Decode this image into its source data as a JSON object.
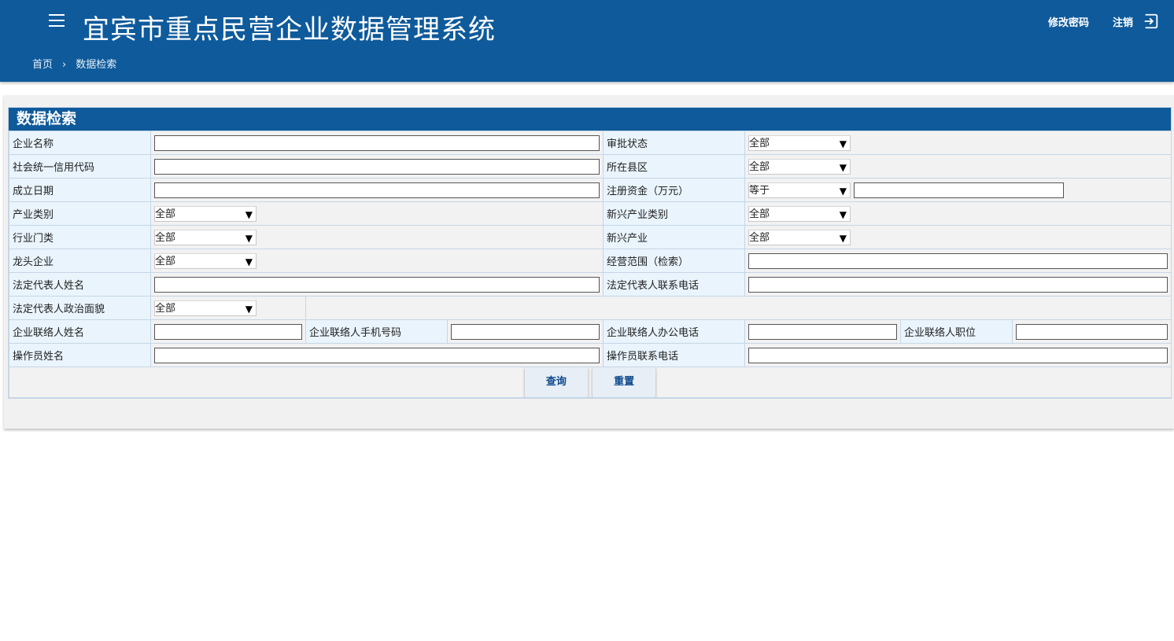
{
  "header": {
    "title": "宜宾市重点民营企业数据管理系统",
    "change_password": "修改密码",
    "logout": "注销"
  },
  "breadcrumb": {
    "home": "首页",
    "separator": "›",
    "current": "数据检索"
  },
  "panel": {
    "title": "数据检索"
  },
  "form": {
    "company_name": {
      "label": "企业名称",
      "value": ""
    },
    "approval_status": {
      "label": "审批状态",
      "value": "全部"
    },
    "credit_code": {
      "label": "社会统一信用代码",
      "value": ""
    },
    "county": {
      "label": "所在县区",
      "value": "全部"
    },
    "established_date": {
      "label": "成立日期",
      "value": ""
    },
    "registered_capital": {
      "label": "注册资金（万元）",
      "operator": "等于",
      "value": ""
    },
    "industry_category": {
      "label": "产业类别",
      "value": "全部"
    },
    "emerging_category": {
      "label": "新兴产业类别",
      "value": "全部"
    },
    "industry_sector": {
      "label": "行业门类",
      "value": "全部"
    },
    "emerging_industry": {
      "label": "新兴产业",
      "value": "全部"
    },
    "leading_enterprise": {
      "label": "龙头企业",
      "value": "全部"
    },
    "business_scope": {
      "label": "经营范围（检索）",
      "value": ""
    },
    "legal_rep_name": {
      "label": "法定代表人姓名",
      "value": ""
    },
    "legal_rep_phone": {
      "label": "法定代表人联系电话",
      "value": ""
    },
    "legal_rep_political": {
      "label": "法定代表人政治面貌",
      "value": "全部"
    },
    "contact_name": {
      "label": "企业联络人姓名",
      "value": ""
    },
    "contact_mobile": {
      "label": "企业联络人手机号码",
      "value": ""
    },
    "contact_office_phone": {
      "label": "企业联络人办公电话",
      "value": ""
    },
    "contact_position": {
      "label": "企业联络人职位",
      "value": ""
    },
    "operator_name": {
      "label": "操作员姓名",
      "value": ""
    },
    "operator_phone": {
      "label": "操作员联系电话",
      "value": ""
    }
  },
  "buttons": {
    "search": "查询",
    "reset": "重置"
  },
  "colors": {
    "brand": "#0e5a9b",
    "label_bg": "#e9f4fc"
  }
}
